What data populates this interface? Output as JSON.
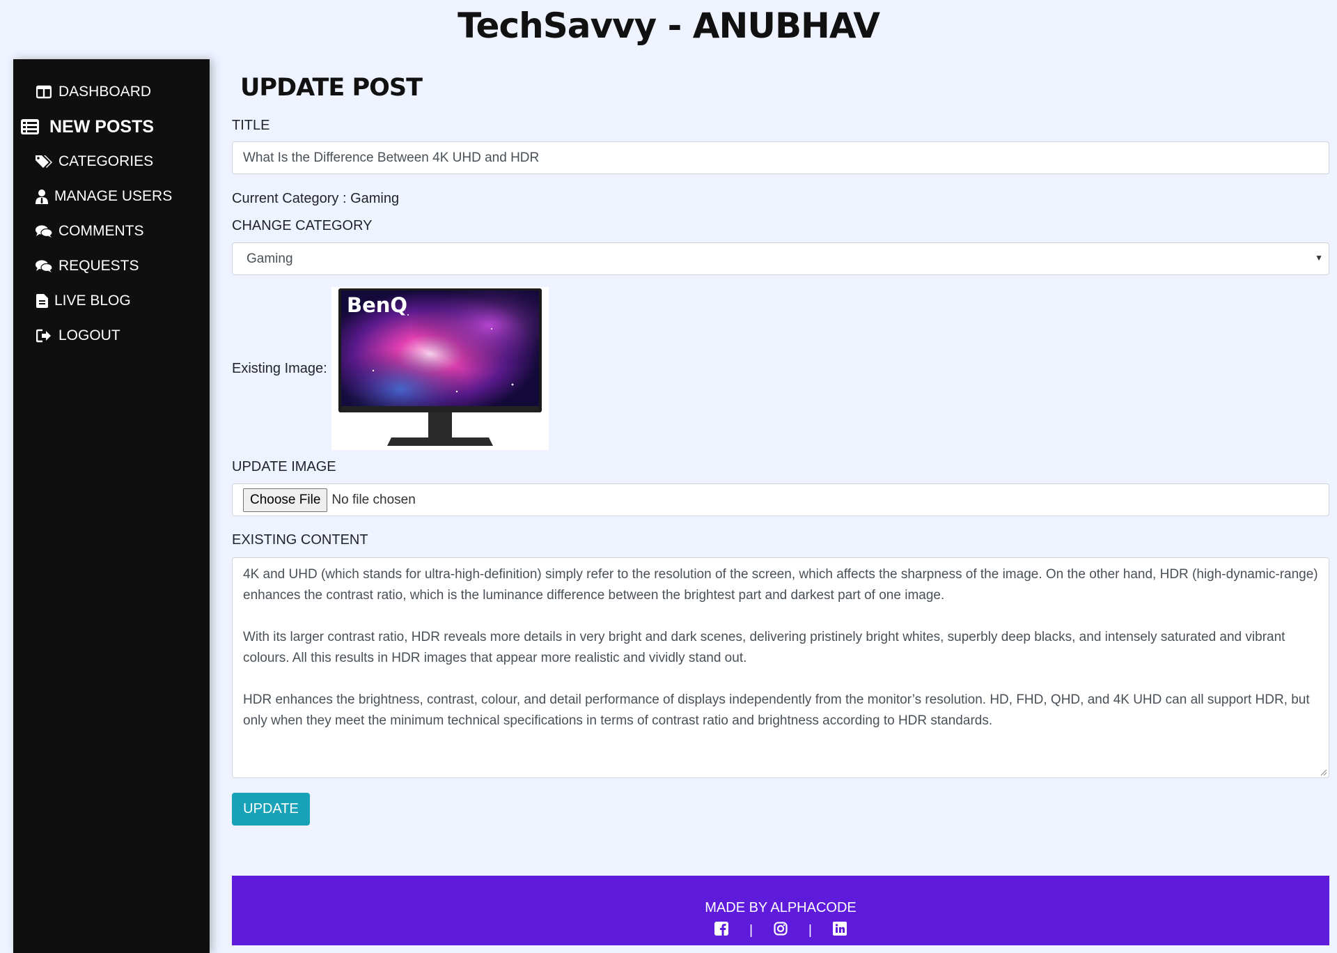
{
  "site": {
    "title": "TechSavvy - ANUBHAV"
  },
  "sidebar": {
    "items": [
      {
        "label": "DASHBOARD",
        "icon": "columns-icon"
      },
      {
        "label": "NEW POSTS",
        "icon": "list-icon",
        "active": true
      },
      {
        "label": "CATEGORIES",
        "icon": "tags-icon"
      },
      {
        "label": "MANAGE USERS",
        "icon": "user-icon"
      },
      {
        "label": "COMMENTS",
        "icon": "comments-icon"
      },
      {
        "label": "REQUESTS",
        "icon": "comments-icon"
      },
      {
        "label": "LIVE BLOG",
        "icon": "blog-file-icon"
      },
      {
        "label": "LOGOUT",
        "icon": "sign-out-icon"
      }
    ]
  },
  "form": {
    "heading": "UPDATE POST",
    "title_label": "TITLE",
    "title_value": "What Is the Difference Between 4K UHD and HDR",
    "current_category": "Current Category : Gaming",
    "change_category_label": "CHANGE CATEGORY",
    "category_selected": "Gaming",
    "existing_image_label": "Existing Image:",
    "image_brand": "BenQ",
    "update_image_label": "UPDATE IMAGE",
    "choose_file_label": "Choose File",
    "no_file_text": "No file chosen",
    "existing_content_label": "EXISTING CONTENT",
    "content_paragraphs": [
      "4K and UHD (which stands for ultra-high-definition) simply refer to the resolution of the screen, which affects the sharpness of the image. On the other hand, HDR (high-dynamic-range) enhances the contrast ratio, which is the luminance difference between the brightest part and darkest part of one image.",
      "With its larger contrast ratio, HDR reveals more details in very bright and dark scenes, delivering pristinely bright whites, superbly deep blacks, and intensely saturated and vibrant colours. All this results in HDR images that appear more realistic and vividly stand out.",
      "HDR enhances the brightness, contrast, colour, and detail performance of displays independently from the monitor’s resolution. HD, FHD, QHD, and 4K UHD can all support HDR, but only when they meet the minimum technical specifications in terms of contrast ratio and brightness according to HDR standards."
    ],
    "update_button": "UPDATE"
  },
  "footer": {
    "text": "MADE BY ALPHACODE",
    "separator": "|",
    "icons": [
      "facebook-icon",
      "instagram-icon",
      "linkedin-icon"
    ]
  },
  "colors": {
    "background": "#eef3ff",
    "sidebar": "#0f0f0f",
    "button": "#17a2b8",
    "footer": "#5f1bdc"
  }
}
